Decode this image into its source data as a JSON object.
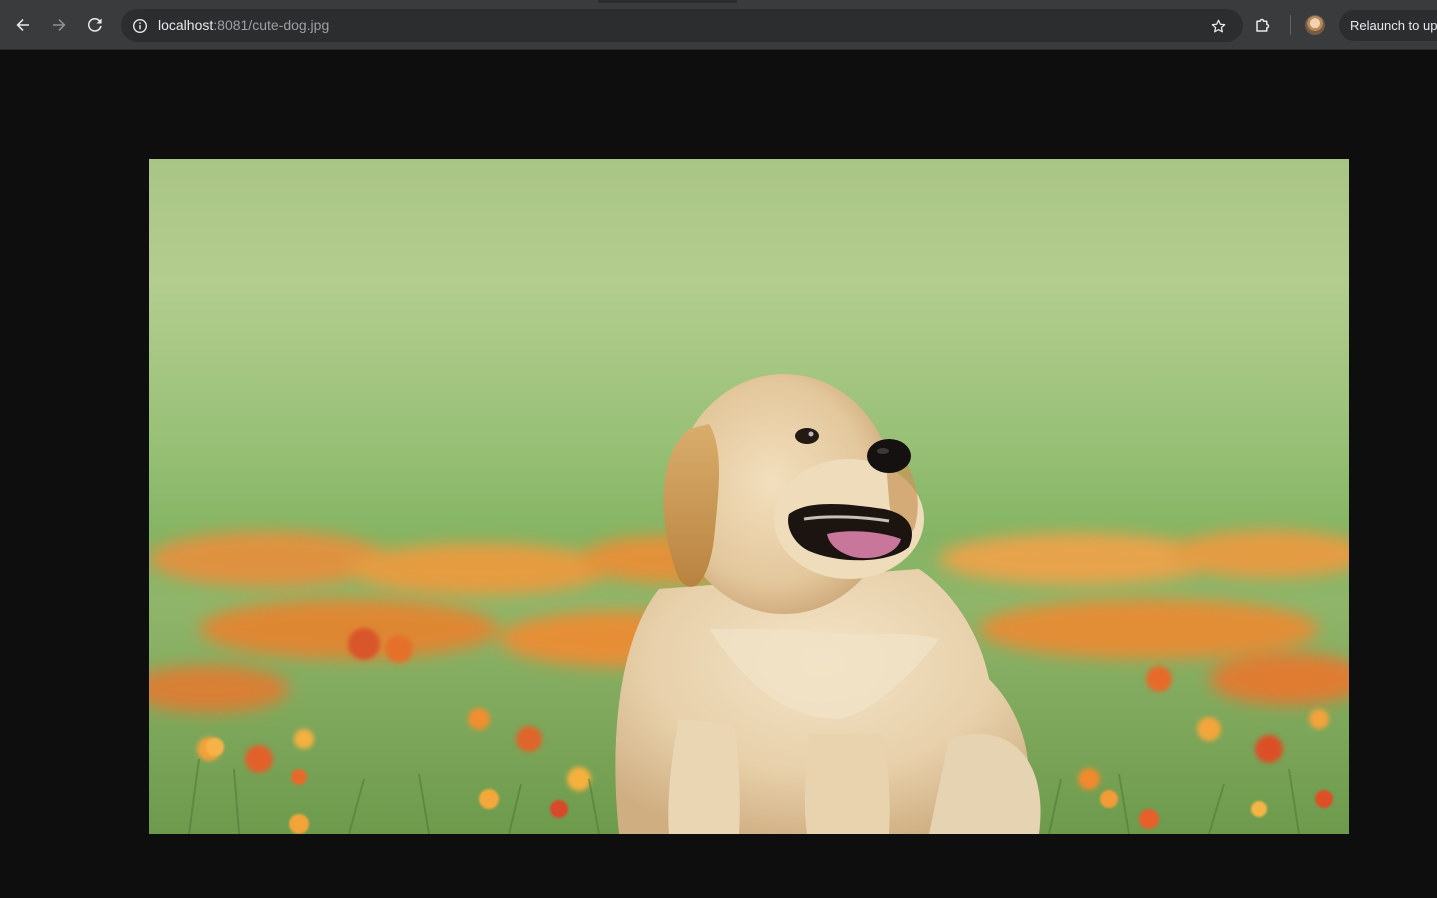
{
  "browser": {
    "url": {
      "host": "localhost",
      "rest": ":8081/cute-dog.jpg"
    },
    "relaunch_label": "Relaunch to up",
    "icons": {
      "back": "arrow-left-icon",
      "forward": "arrow-right-icon",
      "reload": "reload-icon",
      "site_info": "info-circle-icon",
      "bookmark": "star-icon",
      "extensions": "puzzle-icon",
      "profile": "avatar"
    }
  },
  "image": {
    "subject": "cute-dog",
    "colors": {
      "background": "#0e0e0f",
      "grass_top": "#b6c98d",
      "grass_mid": "#7fb060",
      "flowers": "#f08a2a",
      "puppy": "#e8d2ae"
    }
  }
}
